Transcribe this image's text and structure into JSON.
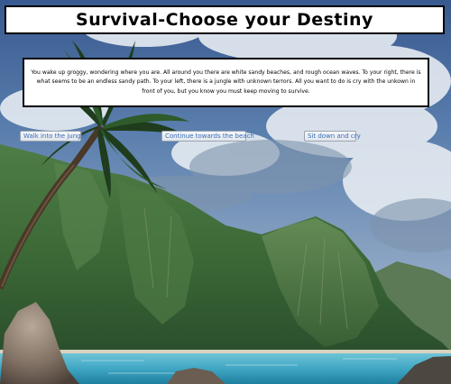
{
  "page": {
    "title": "Survival-Choose your Destiny"
  },
  "story": {
    "text": "You wake up groggy, wondering where you are. All around you there are white sandy beaches, and rough ocean waves. To your right, there is what seems to be an endless sandy path. To your left, there is a jungle with unknown terrors. All you want to do is cry with the unkown in front of you, but you know you must keep moving to survive."
  },
  "choices": [
    {
      "label": "Walk into the jungle"
    },
    {
      "label": "Continue towards the beach"
    },
    {
      "label": "Sit down and cry"
    }
  ],
  "colors": {
    "sky_top": "#3a5f98",
    "cloud": "#e8edf3",
    "mountain": "#3f6b38",
    "ocean": "#3fa6c4",
    "button_text": "#3b6eb8"
  }
}
